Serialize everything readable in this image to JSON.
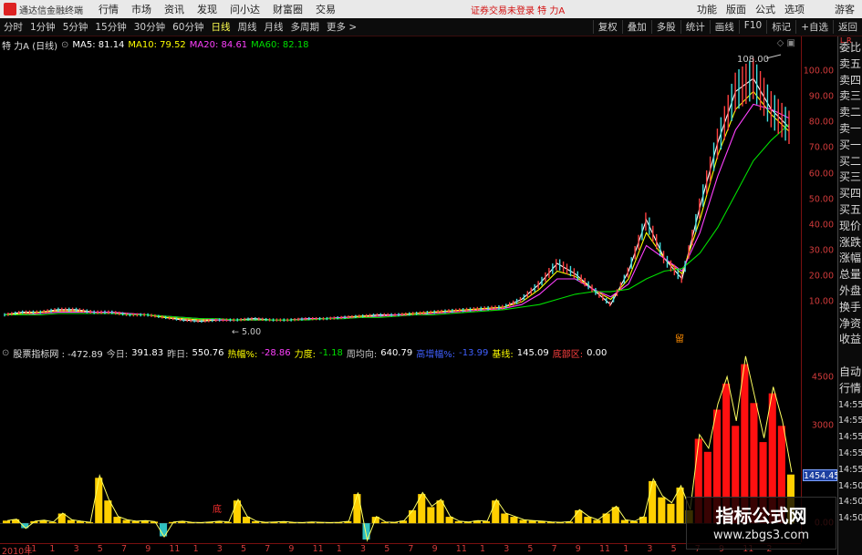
{
  "titlebar": {
    "app_title": "通达信金融终端",
    "menu": [
      "行情",
      "市场",
      "资讯",
      "发现",
      "问小达",
      "财富圈",
      "交易"
    ],
    "notice": "证券交易未登录  特 力A",
    "right": [
      "功能",
      "版面",
      "公式",
      "选项"
    ],
    "guest": "游客"
  },
  "toolbar": {
    "periods": [
      {
        "label": "分时",
        "active": false
      },
      {
        "label": "1分钟",
        "active": false
      },
      {
        "label": "5分钟",
        "active": false
      },
      {
        "label": "15分钟",
        "active": false
      },
      {
        "label": "30分钟",
        "active": false
      },
      {
        "label": "60分钟",
        "active": false
      },
      {
        "label": "日线",
        "active": true
      },
      {
        "label": "周线",
        "active": false
      },
      {
        "label": "月线",
        "active": false
      },
      {
        "label": "多周期",
        "active": false
      },
      {
        "label": "更多 >",
        "active": false
      }
    ],
    "right": [
      "复权",
      "叠加",
      "多股",
      "统计",
      "画线",
      "F10",
      "标记",
      "+自选",
      "返回"
    ]
  },
  "main_legend": {
    "stock": "特 力A (日线)",
    "ma5": "MA5: 81.14",
    "ma10": "MA10: 79.52",
    "ma20": "MA20: 84.61",
    "ma60": "MA60: 82.18",
    "colors": {
      "ma5": "#ffffff",
      "ma10": "#ffff00",
      "ma20": "#ff40ff",
      "ma60": "#00e000"
    }
  },
  "main_annotations": {
    "high": "108.00",
    "low": "5.00",
    "marker": "留"
  },
  "sub_legend": {
    "name": "股票指标网 : -472.89",
    "items": [
      {
        "label": "今日:",
        "value": "391.83",
        "lc": "#c8c8c8",
        "vc": "#ffffff"
      },
      {
        "label": "昨日:",
        "value": "550.76",
        "lc": "#c8c8c8",
        "vc": "#ffffff"
      },
      {
        "label": "热幅%:",
        "value": "-28.86",
        "lc": "#ffff00",
        "vc": "#ff40ff"
      },
      {
        "label": "力度:",
        "value": "-1.18",
        "lc": "#ffff00",
        "vc": "#00e000"
      },
      {
        "label": "周均向:",
        "value": "640.79",
        "lc": "#c8c8c8",
        "vc": "#ffffff"
      },
      {
        "label": "高增幅%:",
        "value": "-13.99",
        "lc": "#4060ff",
        "vc": "#4060ff"
      },
      {
        "label": "基线:",
        "value": "145.09",
        "lc": "#ffff00",
        "vc": "#ffffff"
      },
      {
        "label": "底部区:",
        "value": "0.00",
        "lc": "#ff4040",
        "vc": "#ffffff"
      }
    ],
    "marker": "底"
  },
  "y_axis_main": [
    "100.00",
    "90.00",
    "80.00",
    "70.00",
    "60.00",
    "50.00",
    "40.00",
    "30.00",
    "20.00",
    "10.00"
  ],
  "y_axis_sub": [
    "4500",
    "3000",
    "1500",
    "0.00"
  ],
  "current_value": "1454.45",
  "side_panel": {
    "toggle": "L R",
    "labels": [
      "委比",
      "卖五",
      "卖四",
      "卖三",
      "卖二",
      "卖一",
      "买一",
      "买二",
      "买三",
      "买四",
      "买五",
      "现价",
      "涨跌",
      "涨幅",
      "总量",
      "外盘",
      "换手",
      "净资",
      "收益",
      "",
      "自动",
      "行情",
      "14:55",
      "14:55",
      "14:55",
      "14:55",
      "14:55",
      "14:50",
      "14:50",
      "14:50"
    ]
  },
  "x_axis": [
    "2010年",
    "11",
    "1",
    "3",
    "5",
    "7",
    "9",
    "11",
    "1",
    "3",
    "5",
    "7",
    "9",
    "11",
    "1",
    "3",
    "5",
    "7",
    "9",
    "11",
    "1",
    "3",
    "5",
    "7",
    "9",
    "11",
    "1",
    "3",
    "5",
    "7",
    "9",
    "11",
    "2"
  ],
  "watermark": {
    "title": "指标公式网",
    "url": "www.zbgs3.com"
  },
  "chart_data": [
    {
      "type": "line",
      "title": "特 力A (日线)",
      "ylim": [
        0,
        110
      ],
      "series": [
        {
          "name": "MA5",
          "values": [
            8,
            9,
            9,
            10,
            10,
            9,
            9,
            8,
            8,
            7,
            6,
            5.5,
            6,
            6,
            6.5,
            6,
            6,
            6.5,
            6.5,
            7,
            7.5,
            8,
            8,
            8.5,
            9,
            9.5,
            10,
            10.5,
            11,
            14,
            20,
            28,
            24,
            18,
            12,
            25,
            45,
            30,
            22,
            50,
            75,
            95,
            100,
            88,
            81
          ]
        },
        {
          "name": "MA10",
          "values": [
            8,
            8.5,
            9,
            9.5,
            9.5,
            9,
            9,
            8.5,
            8,
            7,
            6.5,
            6,
            6,
            6,
            6,
            6,
            6,
            6.5,
            6.5,
            7,
            7.5,
            7.5,
            8,
            8.5,
            9,
            9.5,
            10,
            10.5,
            11,
            13,
            18,
            25,
            23,
            18,
            14,
            22,
            40,
            30,
            24,
            45,
            70,
            88,
            95,
            86,
            79.5
          ]
        },
        {
          "name": "MA20",
          "values": [
            8,
            8,
            8.5,
            9,
            9,
            9,
            9,
            8.5,
            8,
            7.5,
            7,
            6.5,
            6,
            6,
            6,
            6,
            6,
            6.5,
            6.5,
            7,
            7,
            7.5,
            8,
            8,
            8.5,
            9,
            9.5,
            10,
            10.5,
            12,
            16,
            22,
            22,
            18,
            15,
            20,
            35,
            30,
            25,
            40,
            62,
            80,
            90,
            88,
            84.6
          ]
        },
        {
          "name": "MA60",
          "values": [
            8,
            8,
            8,
            8.5,
            8.5,
            8.5,
            8.5,
            8,
            8,
            7.5,
            7,
            6.5,
            6.5,
            6,
            6,
            6,
            6,
            6,
            6.5,
            6.5,
            7,
            7,
            7.5,
            8,
            8,
            8.5,
            9,
            9.5,
            10,
            11,
            12,
            14,
            16,
            17,
            17,
            18,
            22,
            25,
            26,
            32,
            42,
            55,
            68,
            76,
            82.2
          ]
        }
      ]
    },
    {
      "type": "bar",
      "title": "股票指标网",
      "ylim": [
        -500,
        5000
      ],
      "values": [
        80,
        120,
        -150,
        60,
        90,
        40,
        300,
        100,
        60,
        30,
        1400,
        700,
        200,
        100,
        60,
        80,
        50,
        -400,
        40,
        60,
        30,
        20,
        40,
        60,
        40,
        700,
        200,
        60,
        30,
        40,
        50,
        30,
        20,
        40,
        30,
        20,
        30,
        60,
        900,
        -500,
        200,
        40,
        30,
        80,
        400,
        900,
        500,
        700,
        200,
        60,
        40,
        80,
        60,
        700,
        300,
        200,
        100,
        80,
        60,
        40,
        30,
        50,
        400,
        200,
        100,
        300,
        500,
        100,
        60,
        200,
        1300,
        800,
        600,
        1100,
        400,
        2600,
        2200,
        3500,
        4300,
        3000,
        4900,
        3700,
        2500,
        4000,
        3000,
        1500
      ]
    }
  ]
}
